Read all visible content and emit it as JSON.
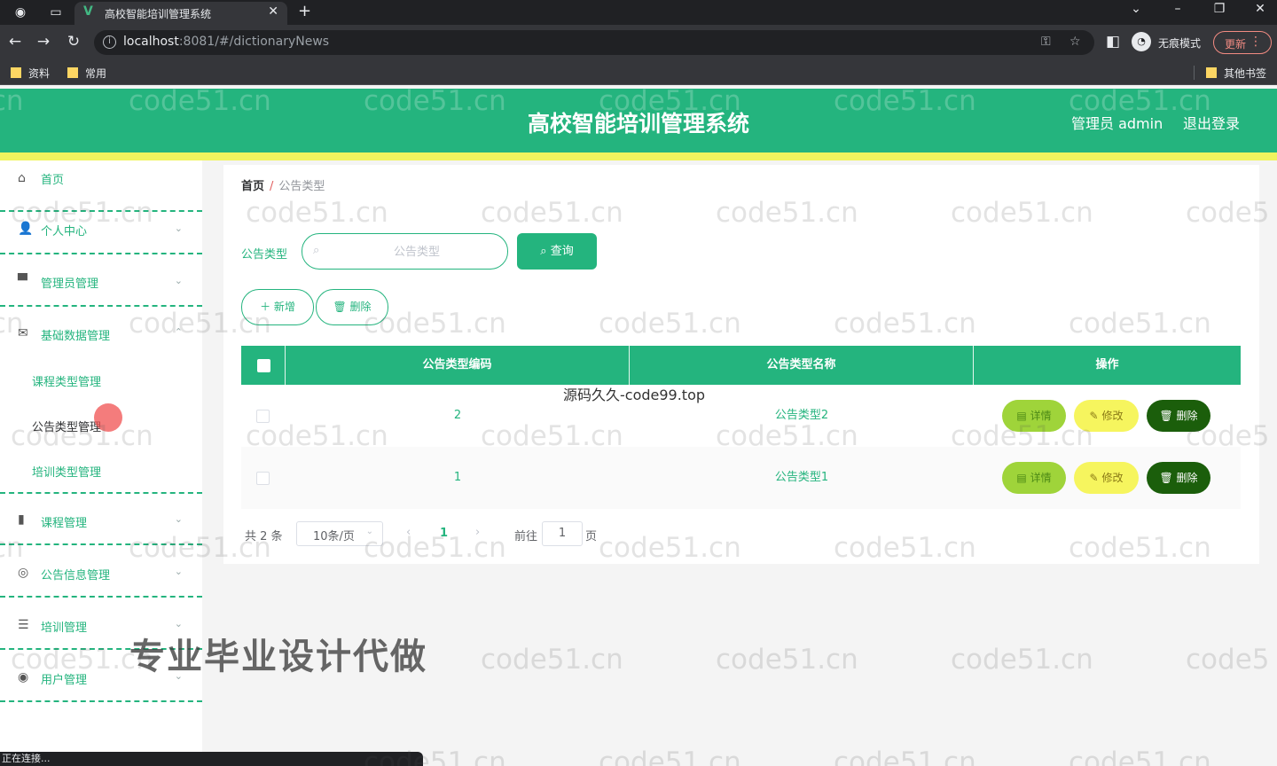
{
  "browser": {
    "tab_title": "高校智能培训管理系统",
    "url_host": "localhost",
    "url_rest": ":8081/#/dictionaryNews",
    "incognito_label": "无痕模式",
    "update_label": "更新",
    "bookmarks": [
      "资料",
      "常用"
    ],
    "other_bookmarks": "其他书签",
    "status_text": "正在连接..."
  },
  "header": {
    "title": "高校智能培训管理系统",
    "user_label": "管理员 admin",
    "logout_label": "退出登录"
  },
  "sidebar": {
    "items": [
      {
        "label": "首页",
        "icon": "home-icon"
      },
      {
        "label": "个人中心",
        "icon": "user-icon"
      },
      {
        "label": "管理员管理",
        "icon": "manager-icon"
      },
      {
        "label": "基础数据管理",
        "icon": "mail-icon"
      },
      {
        "label": "课程管理",
        "icon": "chart-icon"
      },
      {
        "label": "公告信息管理",
        "icon": "compass-icon"
      },
      {
        "label": "培训管理",
        "icon": "list-icon"
      },
      {
        "label": "用户管理",
        "icon": "target-icon"
      }
    ],
    "sub_items": [
      "课程类型管理",
      "公告类型管理",
      "培训类型管理"
    ]
  },
  "breadcrumb": {
    "home": "首页",
    "separator": "/",
    "current": "公告类型"
  },
  "search": {
    "label": "公告类型",
    "placeholder": "公告类型",
    "button_label": "查询"
  },
  "actions": {
    "add_label": "＋ 新增",
    "delete_label": "删除"
  },
  "table": {
    "columns": [
      "公告类型编码",
      "公告类型名称",
      "操作"
    ],
    "rows": [
      {
        "code": "2",
        "name": "公告类型2"
      },
      {
        "code": "1",
        "name": "公告类型1"
      }
    ],
    "row_actions": {
      "detail": "详情",
      "edit": "修改",
      "delete": "删除"
    }
  },
  "pagination": {
    "total": "共 2 条",
    "page_size": "10条/页",
    "current_page": "1",
    "goto_label": "前往",
    "goto_value": "1",
    "page_suffix": "页"
  },
  "overlays": {
    "watermark": "code51.cn",
    "watermark_edge": "code5",
    "promo": "专业毕业设计代做",
    "source": "源码久久-code99.top"
  },
  "colors": {
    "primary": "#24b47e",
    "strip": "#f0f45e",
    "detail": "#9fd43a",
    "edit": "#f6f55e",
    "danger": "#1b5e0b"
  }
}
